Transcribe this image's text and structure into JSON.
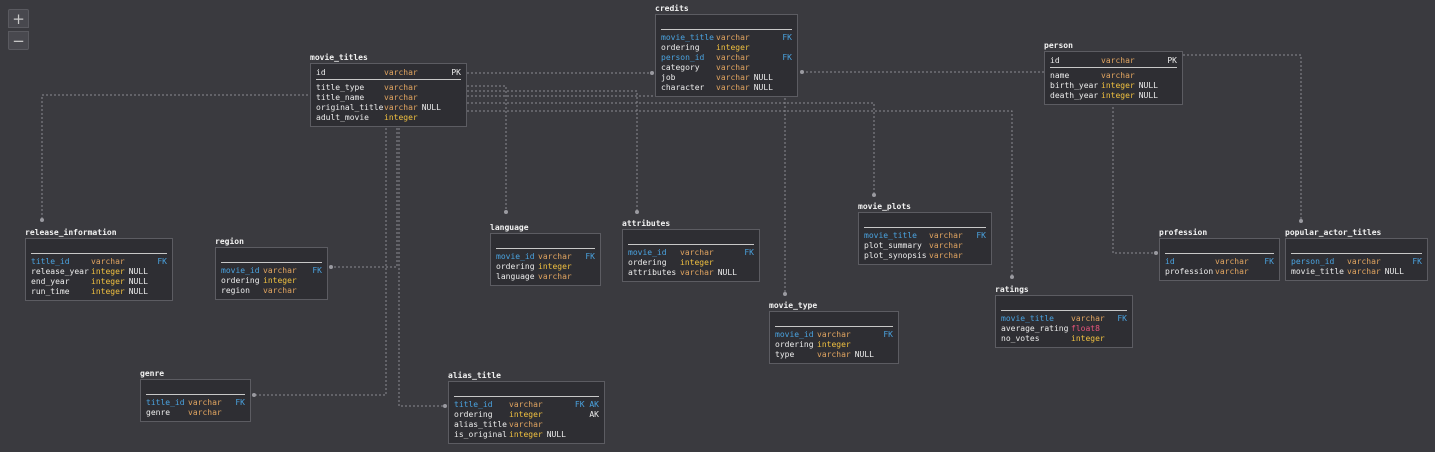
{
  "zoom": {
    "in_label": "+",
    "out_label": "−"
  },
  "tables": {
    "credits": {
      "name": "credits",
      "rows": [
        {
          "col": "movie_title",
          "type": "varchar",
          "null": "",
          "key": "FK",
          "fk": true
        },
        {
          "col": "ordering",
          "type": "integer",
          "null": "",
          "key": "",
          "fk": false
        },
        {
          "col": "person_id",
          "type": "varchar",
          "null": "",
          "key": "FK",
          "fk": true
        },
        {
          "col": "category",
          "type": "varchar",
          "null": "",
          "key": "",
          "fk": false
        },
        {
          "col": "job",
          "type": "varchar",
          "null": "NULL",
          "key": "",
          "fk": false
        },
        {
          "col": "character",
          "type": "varchar",
          "null": "NULL",
          "key": "",
          "fk": false
        }
      ]
    },
    "movie_titles": {
      "name": "movie_titles",
      "pk": {
        "col": "id",
        "type": "varchar",
        "key": "PK"
      },
      "rows": [
        {
          "col": "title_type",
          "type": "varchar",
          "null": "",
          "key": "",
          "fk": false
        },
        {
          "col": "title_name",
          "type": "varchar",
          "null": "",
          "key": "",
          "fk": false
        },
        {
          "col": "original_title",
          "type": "varchar",
          "null": "NULL",
          "key": "",
          "fk": false
        },
        {
          "col": "adult_movie",
          "type": "integer",
          "null": "",
          "key": "",
          "fk": false
        }
      ]
    },
    "person": {
      "name": "person",
      "pk": {
        "col": "id",
        "type": "varchar",
        "key": "PK"
      },
      "rows": [
        {
          "col": "name",
          "type": "varchar",
          "null": "",
          "key": "",
          "fk": false
        },
        {
          "col": "birth_year",
          "type": "integer",
          "null": "NULL",
          "key": "",
          "fk": false
        },
        {
          "col": "death_year",
          "type": "integer",
          "null": "NULL",
          "key": "",
          "fk": false
        }
      ]
    },
    "release_information": {
      "name": "release_information",
      "rows": [
        {
          "col": "title_id",
          "type": "varchar",
          "null": "",
          "key": "FK",
          "fk": true
        },
        {
          "col": "release_year",
          "type": "integer",
          "null": "NULL",
          "key": "",
          "fk": false
        },
        {
          "col": "end_year",
          "type": "integer",
          "null": "NULL",
          "key": "",
          "fk": false
        },
        {
          "col": "run_time",
          "type": "integer",
          "null": "NULL",
          "key": "",
          "fk": false
        }
      ]
    },
    "region": {
      "name": "region",
      "rows": [
        {
          "col": "movie_id",
          "type": "varchar",
          "null": "",
          "key": "FK",
          "fk": true
        },
        {
          "col": "ordering",
          "type": "integer",
          "null": "",
          "key": "",
          "fk": false
        },
        {
          "col": "region",
          "type": "varchar",
          "null": "",
          "key": "",
          "fk": false
        }
      ]
    },
    "language": {
      "name": "language",
      "rows": [
        {
          "col": "movie_id",
          "type": "varchar",
          "null": "",
          "key": "FK",
          "fk": true
        },
        {
          "col": "ordering",
          "type": "integer",
          "null": "",
          "key": "",
          "fk": false
        },
        {
          "col": "language",
          "type": "varchar",
          "null": "",
          "key": "",
          "fk": false
        }
      ]
    },
    "attributes": {
      "name": "attributes",
      "rows": [
        {
          "col": "movie_id",
          "type": "varchar",
          "null": "",
          "key": "FK",
          "fk": true
        },
        {
          "col": "ordering",
          "type": "integer",
          "null": "",
          "key": "",
          "fk": false
        },
        {
          "col": "attributes",
          "type": "varchar",
          "null": "NULL",
          "key": "",
          "fk": false
        }
      ]
    },
    "movie_plots": {
      "name": "movie_plots",
      "rows": [
        {
          "col": "movie_title",
          "type": "varchar",
          "null": "",
          "key": "FK",
          "fk": true
        },
        {
          "col": "plot_summary",
          "type": "varchar",
          "null": "",
          "key": "",
          "fk": false
        },
        {
          "col": "plot_synopsis",
          "type": "varchar",
          "null": "",
          "key": "",
          "fk": false
        }
      ]
    },
    "profession": {
      "name": "profession",
      "rows": [
        {
          "col": "id",
          "type": "varchar",
          "null": "",
          "key": "FK",
          "fk": true
        },
        {
          "col": "profession",
          "type": "varchar",
          "null": "",
          "key": "",
          "fk": false
        }
      ]
    },
    "popular_actor_titles": {
      "name": "popular_actor_titles",
      "rows": [
        {
          "col": "person_id",
          "type": "varchar",
          "null": "",
          "key": "FK",
          "fk": true
        },
        {
          "col": "movie_title",
          "type": "varchar",
          "null": "NULL",
          "key": "",
          "fk": false
        }
      ]
    },
    "ratings": {
      "name": "ratings",
      "rows": [
        {
          "col": "movie_title",
          "type": "varchar",
          "null": "",
          "key": "FK",
          "fk": true
        },
        {
          "col": "average_rating",
          "type": "float8",
          "null": "",
          "key": "",
          "fk": false
        },
        {
          "col": "no_votes",
          "type": "integer",
          "null": "",
          "key": "",
          "fk": false
        }
      ]
    },
    "movie_type": {
      "name": "movie_type",
      "rows": [
        {
          "col": "movie_id",
          "type": "varchar",
          "null": "",
          "key": "FK",
          "fk": true
        },
        {
          "col": "ordering",
          "type": "integer",
          "null": "",
          "key": "",
          "fk": false
        },
        {
          "col": "type",
          "type": "varchar",
          "null": "NULL",
          "key": "",
          "fk": false
        }
      ]
    },
    "genre": {
      "name": "genre",
      "rows": [
        {
          "col": "title_id",
          "type": "varchar",
          "null": "",
          "key": "FK",
          "fk": true
        },
        {
          "col": "genre",
          "type": "varchar",
          "null": "",
          "key": "",
          "fk": false
        }
      ]
    },
    "alias_title": {
      "name": "alias_title",
      "rows": [
        {
          "col": "title_id",
          "type": "varchar",
          "null": "",
          "key": "FK AK",
          "fk": true
        },
        {
          "col": "ordering",
          "type": "integer",
          "null": "",
          "key": "AK",
          "fk": false
        },
        {
          "col": "alias_title",
          "type": "varchar",
          "null": "",
          "key": "",
          "fk": false
        },
        {
          "col": "is_original",
          "type": "integer",
          "null": "NULL",
          "key": "",
          "fk": false
        }
      ]
    }
  }
}
